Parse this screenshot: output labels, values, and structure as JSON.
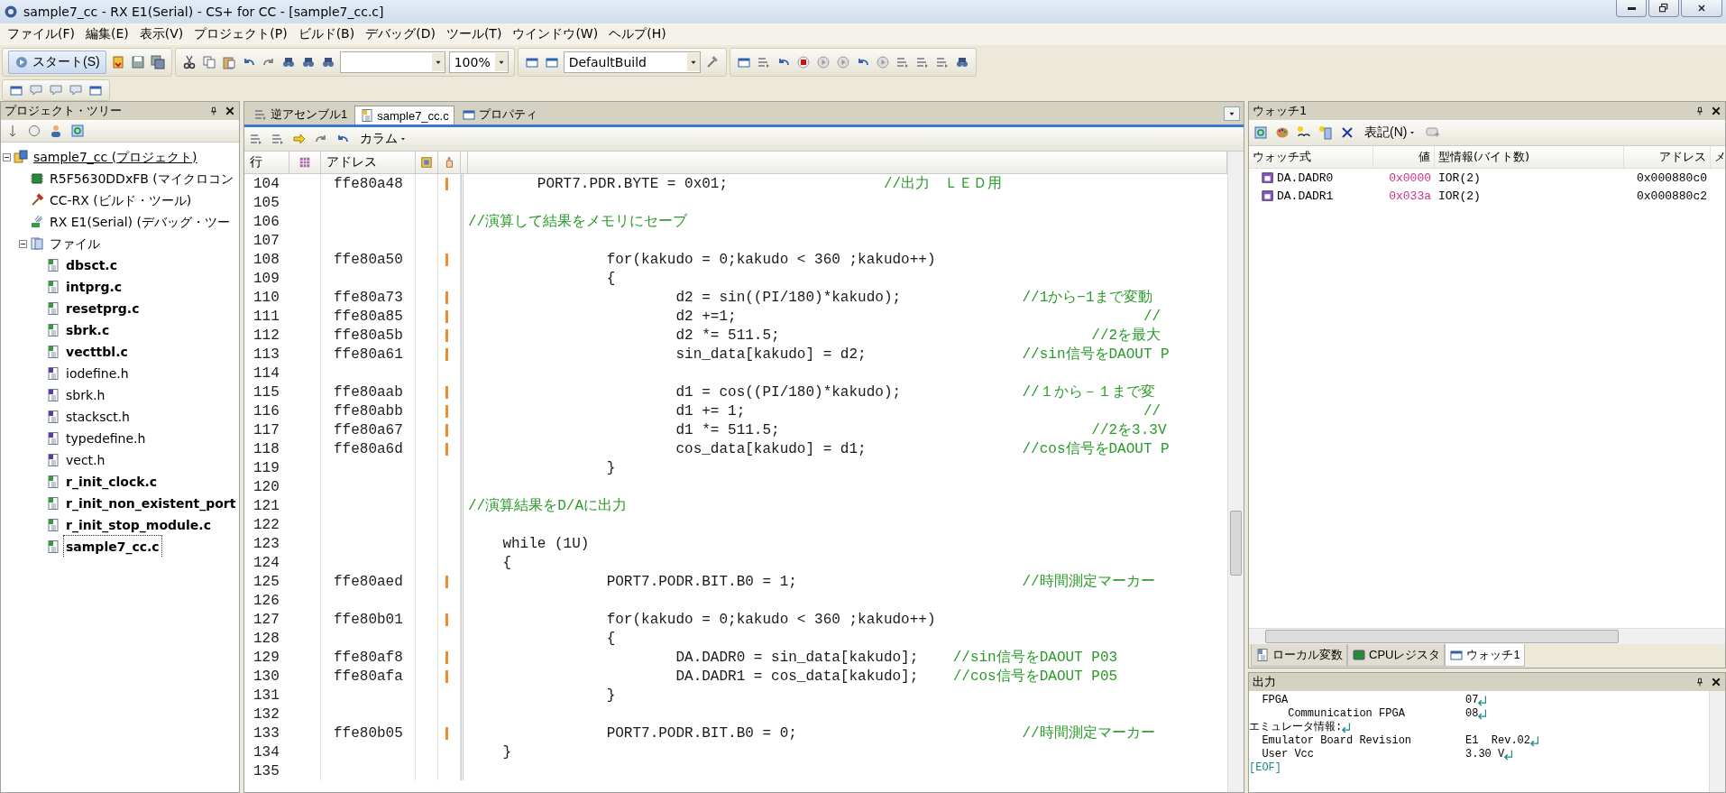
{
  "window": {
    "title": "sample7_cc - RX E1(Serial) - CS+ for CC - [sample7_cc.c]"
  },
  "menu": [
    "ファイル(F)",
    "編集(E)",
    "表示(V)",
    "プロジェクト(P)",
    "ビルド(B)",
    "デバッグ(D)",
    "ツール(T)",
    "ウインドウ(W)",
    "ヘルプ(H)"
  ],
  "toolbar": {
    "start_button": "スタート(S)",
    "zoom": "100%",
    "build_config": "DefaultBuild"
  },
  "project_tree": {
    "title": "プロジェクト・ツリー",
    "items": [
      {
        "label": "sample7_cc (プロジェクト)",
        "kind": "project",
        "bold": false,
        "selected": false,
        "expanded": true,
        "children": [
          {
            "label": "R5F5630DDxFB (マイクロコン",
            "kind": "device",
            "bold": false,
            "selected": false
          },
          {
            "label": "CC-RX (ビルド・ツール)",
            "kind": "build_tool",
            "bold": false,
            "selected": false
          },
          {
            "label": "RX E1(Serial) (デバッグ・ツー",
            "kind": "debug_tool",
            "bold": false,
            "selected": false
          },
          {
            "label": "ファイル",
            "kind": "folder",
            "bold": false,
            "selected": false,
            "expanded": true,
            "children": [
              {
                "label": "dbsct.c",
                "kind": "c_file",
                "bold": true,
                "selected": false
              },
              {
                "label": "intprg.c",
                "kind": "c_file",
                "bold": true,
                "selected": false
              },
              {
                "label": "resetprg.c",
                "kind": "c_file",
                "bold": true,
                "selected": false
              },
              {
                "label": "sbrk.c",
                "kind": "c_file",
                "bold": true,
                "selected": false
              },
              {
                "label": "vecttbl.c",
                "kind": "c_file",
                "bold": true,
                "selected": false
              },
              {
                "label": "iodefine.h",
                "kind": "h_file",
                "bold": false,
                "selected": false
              },
              {
                "label": "sbrk.h",
                "kind": "h_file",
                "bold": false,
                "selected": false
              },
              {
                "label": "stacksct.h",
                "kind": "h_file",
                "bold": false,
                "selected": false
              },
              {
                "label": "typedefine.h",
                "kind": "h_file",
                "bold": false,
                "selected": false
              },
              {
                "label": "vect.h",
                "kind": "h_file",
                "bold": false,
                "selected": false
              },
              {
                "label": "r_init_clock.c",
                "kind": "c_file",
                "bold": true,
                "selected": false
              },
              {
                "label": "r_init_non_existent_port",
                "kind": "c_file",
                "bold": true,
                "selected": false
              },
              {
                "label": "r_init_stop_module.c",
                "kind": "c_file",
                "bold": true,
                "selected": false
              },
              {
                "label": "sample7_cc.c",
                "kind": "c_file",
                "bold": true,
                "selected": true
              }
            ]
          }
        ]
      }
    ]
  },
  "editor": {
    "tabs": [
      {
        "label": "逆アセンブル1",
        "selected": false
      },
      {
        "label": "sample7_cc.c",
        "selected": true
      },
      {
        "label": "プロパティ",
        "selected": false
      }
    ],
    "column_menu": "カラム",
    "columns": [
      "行",
      "アドレス"
    ],
    "lines": [
      {
        "number": "104",
        "address": "ffe80a48",
        "marked": true,
        "code": "\tPORT7.PDR.BYTE = 0x01;\t\t\t",
        "comment": "//出力　ＬＥＤ用"
      },
      {
        "number": "105",
        "marked": false
      },
      {
        "number": "106",
        "marked": false,
        "comment": "//演算して結果をメモリにセーブ"
      },
      {
        "number": "107",
        "marked": false
      },
      {
        "number": "108",
        "address": "ffe80a50",
        "marked": true,
        "code": "\t\tfor(kakudo = 0;kakudo < 360 ;kakudo++)"
      },
      {
        "number": "109",
        "marked": false,
        "code": "\t\t{"
      },
      {
        "number": "110",
        "address": "ffe80a73",
        "marked": true,
        "code": "\t\t\td2 = sin((PI/180)*kakudo);\t\t",
        "comment": "//1から−1まで変動"
      },
      {
        "number": "111",
        "address": "ffe80a85",
        "marked": true,
        "code": "\t\t\td2 +=1;\t\t\t\t\t\t      ",
        "comment": "//"
      },
      {
        "number": "112",
        "address": "ffe80a5b",
        "marked": true,
        "code": "\t\t\td2 *= 511.5;\t\t\t\t\t",
        "comment": "//2を最大"
      },
      {
        "number": "113",
        "address": "ffe80a61",
        "marked": true,
        "code": "\t\t\tsin_data[kakudo] = d2;\t\t\t",
        "comment": "//sin信号をDAOUT P"
      },
      {
        "number": "114",
        "marked": false
      },
      {
        "number": "115",
        "address": "ffe80aab",
        "marked": true,
        "code": "\t\t\td1 = cos((PI/180)*kakudo);\t\t",
        "comment": "//１から－１まで変"
      },
      {
        "number": "116",
        "address": "ffe80abb",
        "marked": true,
        "code": "\t\t\td1 += 1;\t\t\t\t\t      ",
        "comment": "//"
      },
      {
        "number": "117",
        "address": "ffe80a67",
        "marked": true,
        "code": "\t\t\td1 *= 511.5;\t\t\t\t\t",
        "comment": "//2を3.3V"
      },
      {
        "number": "118",
        "address": "ffe80a6d",
        "marked": true,
        "code": "\t\t\tcos_data[kakudo] = d1;\t\t\t",
        "comment": "//cos信号をDAOUT P"
      },
      {
        "number": "119",
        "marked": false,
        "code": "\t\t}"
      },
      {
        "number": "120",
        "marked": false
      },
      {
        "number": "121",
        "marked": false,
        "comment": "//演算結果をD/Aに出力"
      },
      {
        "number": "122",
        "marked": false
      },
      {
        "number": "123",
        "marked": false,
        "code": "    while (1U)"
      },
      {
        "number": "124",
        "marked": false,
        "code": "    {"
      },
      {
        "number": "125",
        "address": "ffe80aed",
        "marked": true,
        "code": "\t\tPORT7.PODR.BIT.B0 = 1;\t\t\t\t",
        "comment": "//時間測定マーカー"
      },
      {
        "number": "126",
        "marked": false
      },
      {
        "number": "127",
        "address": "ffe80b01",
        "marked": true,
        "code": "\t\tfor(kakudo = 0;kakudo < 360 ;kakudo++)"
      },
      {
        "number": "128",
        "marked": false,
        "code": "\t\t{"
      },
      {
        "number": "129",
        "address": "ffe80af8",
        "marked": true,
        "code": "\t\t\tDA.DADR0 = sin_data[kakudo];\t",
        "comment": "//sin信号をDAOUT P03"
      },
      {
        "number": "130",
        "address": "ffe80afa",
        "marked": true,
        "code": "\t\t\tDA.DADR1 = cos_data[kakudo];\t",
        "comment": "//cos信号をDAOUT P05"
      },
      {
        "number": "131",
        "marked": false,
        "code": "\t\t}"
      },
      {
        "number": "132",
        "marked": false
      },
      {
        "number": "133",
        "address": "ffe80b05",
        "marked": true,
        "code": "\t\tPORT7.PODR.BIT.B0 = 0;\t\t\t\t",
        "comment": "//時間測定マーカー"
      },
      {
        "number": "134",
        "marked": false,
        "code": "    }"
      },
      {
        "number": "135",
        "marked": false
      }
    ]
  },
  "watch": {
    "title": "ウォッチ1",
    "notation_menu": "表記(N)",
    "columns": [
      "ウォッチ式",
      "値",
      "型情報(バイト数)",
      "アドレス",
      "メ"
    ],
    "rows": [
      {
        "name": "DA.DADR0",
        "value": "0x0000",
        "type": "IOR(2)",
        "address": "0x000880c0"
      },
      {
        "name": "DA.DADR1",
        "value": "0x033a",
        "type": "IOR(2)",
        "address": "0x000880c2"
      }
    ]
  },
  "bottom_tabs": [
    {
      "label": "ローカル変数",
      "selected": false
    },
    {
      "label": "CPUレジスタ",
      "selected": false
    },
    {
      "label": "ウォッチ1",
      "selected": true
    }
  ],
  "output": {
    "title": "出力",
    "lines": [
      {
        "kind": "entry",
        "label": "  FPGA",
        "value": "07",
        "eol": true
      },
      {
        "kind": "entry",
        "label": "      Communication FPGA",
        "value": "08",
        "eol": true
      },
      {
        "kind": "heading",
        "label": "エミュレータ情報:",
        "eol": true
      },
      {
        "kind": "entry",
        "label": "  Emulator Board Revision",
        "value": "E1  Rev.02",
        "eol": true
      },
      {
        "kind": "entry",
        "label": "  User Vcc",
        "value": "3.30 V",
        "eol": true
      },
      {
        "kind": "eof",
        "label": "[EOF]",
        "eol": false
      }
    ]
  }
}
